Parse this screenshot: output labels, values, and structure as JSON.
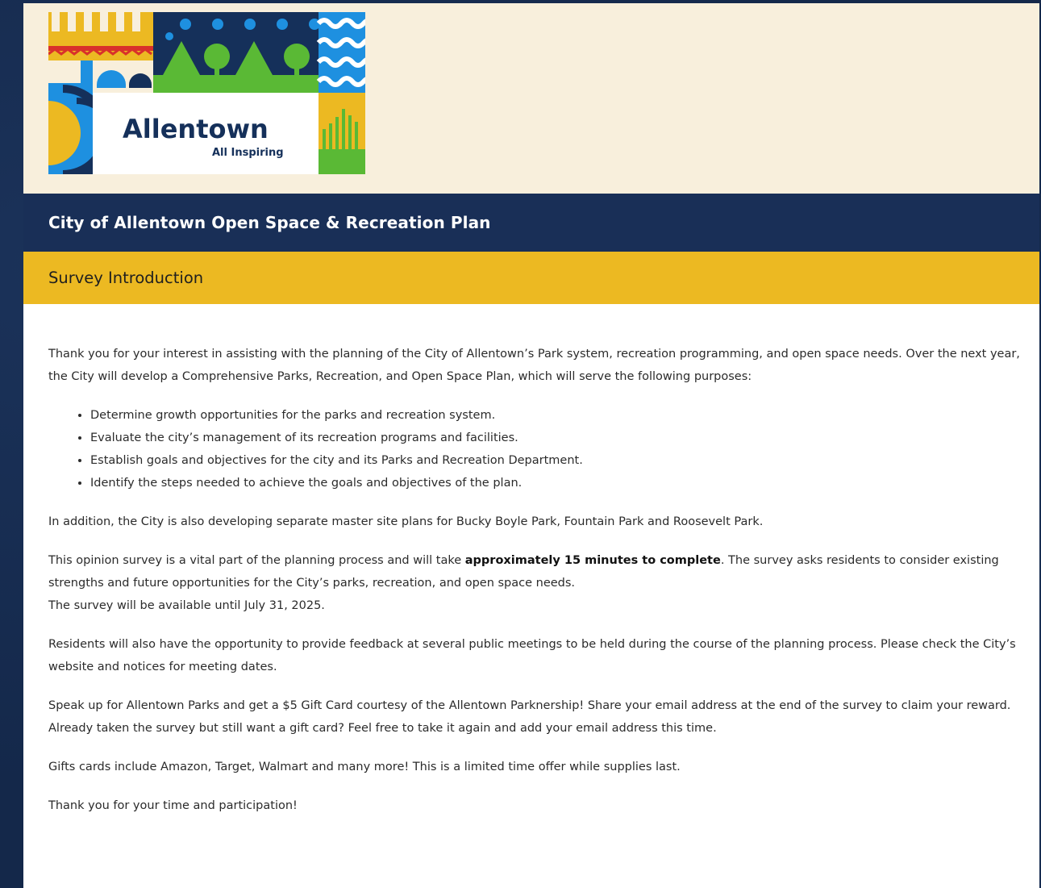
{
  "logo": {
    "wordmark": "Allentown",
    "tagline": "All Inspiring"
  },
  "header": {
    "title": "City of Allentown Open Space & Recreation Plan"
  },
  "section": {
    "title": "Survey Introduction"
  },
  "intro": {
    "p1": "Thank you for your interest in assisting with the planning of the City of Allentown’s Park system, recreation programming, and open space needs. Over the next year, the City will develop a Comprehensive Parks, Recreation, and Open Space Plan, which will serve the following purposes:",
    "purposes": [
      "Determine growth opportunities for the parks and recreation system.",
      "Evaluate the city’s management of its recreation programs and facilities.",
      "Establish goals and objectives for the city and its Parks and Recreation Department.",
      "Identify the steps needed to achieve the goals and objectives of the plan."
    ],
    "p2": "In addition, the City is also developing separate master site plans for Bucky Boyle Park, Fountain Park and Roosevelt Park.",
    "p3_before": "This opinion survey is a vital part of the planning process and will take ",
    "p3_bold": "approximately 15 minutes to complete",
    "p3_after": ". The survey asks residents to consider existing strengths and future opportunities for the City’s parks, recreation, and open space needs.",
    "p3_line2": "The survey will be available until July 31, 2025.",
    "p4": "Residents will also have the opportunity to provide feedback at several public meetings to be held during the course of the planning process. Please check the City’s website and notices for meeting dates.",
    "p5": "Speak up for Allentown Parks and get a $5 Gift Card courtesy of the Allentown Parknership! Share your email address at the end of the survey to claim your reward. Already taken the survey but still want a gift card? Feel free to take it again and add your email address this time.",
    "p6": "Gifts cards include Amazon, Target, Walmart and many more! This is a limited time offer while supplies last.",
    "p7": "Thank you for your time and participation!"
  },
  "colors": {
    "navy": "#192f57",
    "gold": "#ecb922",
    "cream": "#f8efdc",
    "blue": "#1e90e0",
    "green": "#5ab935"
  }
}
